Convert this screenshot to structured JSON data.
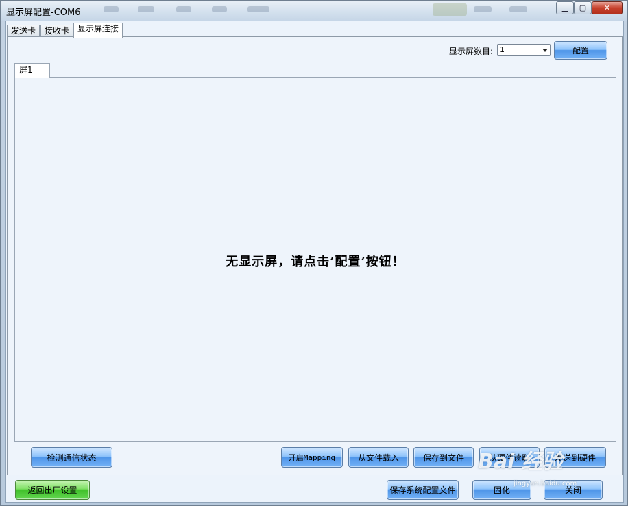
{
  "window": {
    "title": "显示屏配置-COM6"
  },
  "tabs": [
    {
      "label": "发送卡",
      "active": false
    },
    {
      "label": "接收卡",
      "active": false
    },
    {
      "label": "显示屏连接",
      "active": true
    }
  ],
  "config": {
    "count_label": "显示屏数目:",
    "count_value": "1",
    "config_button": "配置"
  },
  "screens": {
    "tab_label": "屏1",
    "empty_message": "无显示屏，请点击’配置’按钮！"
  },
  "panel_buttons": {
    "check_comm": "检测通信状态",
    "open_mapping": "开启Mapping",
    "load_file": "从文件载入",
    "save_file": "保存到文件",
    "read_hardware": "从硬件读取",
    "send_hardware": "发送到硬件"
  },
  "footer_buttons": {
    "factory_reset": "返回出厂设置",
    "save_system": "保存系统配置文件",
    "solidify": "固化",
    "close": "关闭"
  },
  "watermark": {
    "text": "Bai 经验",
    "sub": "jingyan.baidu.com"
  },
  "colors": {
    "button_blue": "#74b2f6",
    "button_green": "#40c02a",
    "panel_bg": "#eef4fb"
  }
}
